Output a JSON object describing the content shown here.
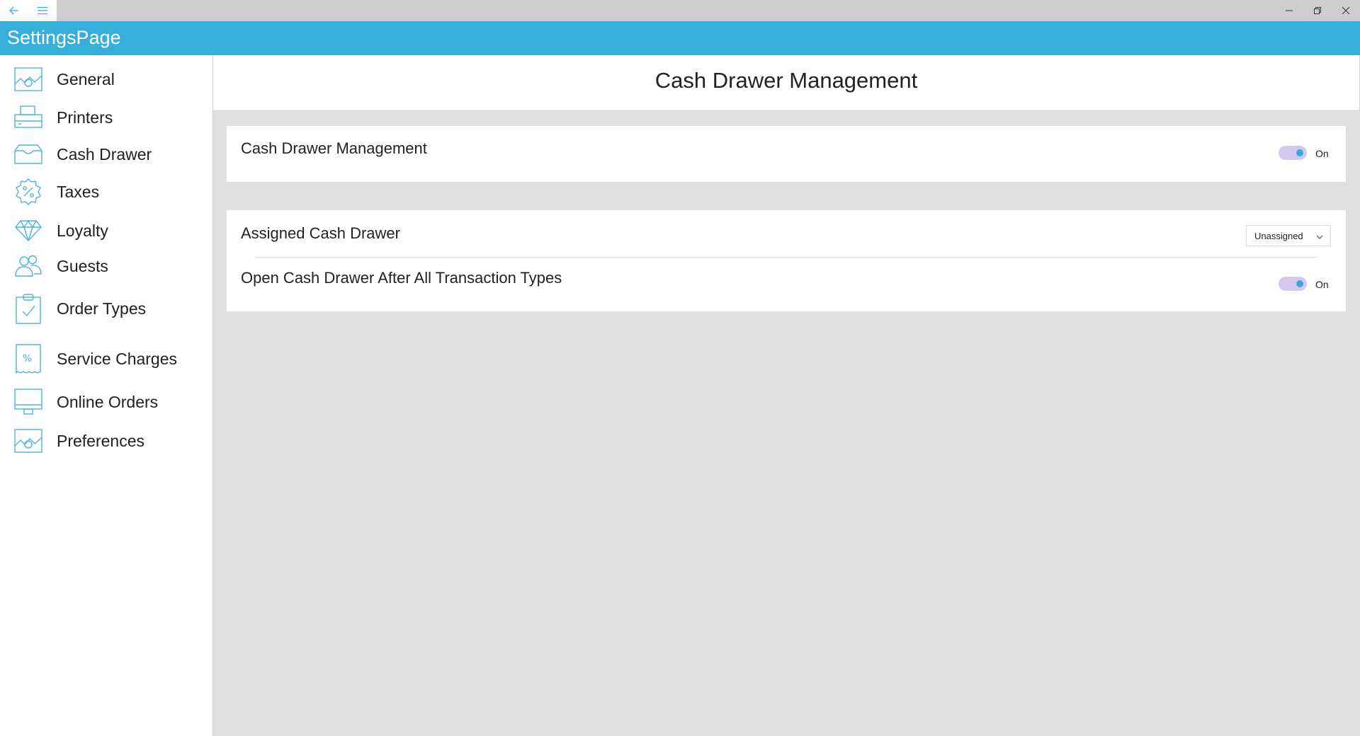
{
  "window": {
    "back_icon": "back-arrow-icon",
    "menu_icon": "hamburger-icon",
    "controls": [
      "minimize-icon",
      "restore-icon",
      "close-icon"
    ]
  },
  "app": {
    "title": "SettingsPage",
    "accent": "#38aedb"
  },
  "sidebar": {
    "items": [
      {
        "label": "General",
        "icon": "settings-gear-icon"
      },
      {
        "label": "Printers",
        "icon": "printer-icon"
      },
      {
        "label": "Cash Drawer",
        "icon": "cash-drawer-icon"
      },
      {
        "label": "Taxes",
        "icon": "percent-badge-icon"
      },
      {
        "label": "Loyalty",
        "icon": "diamond-icon"
      },
      {
        "label": "Guests",
        "icon": "guests-icon"
      },
      {
        "label": "Order Types",
        "icon": "clipboard-check-icon"
      },
      {
        "label": "Service Charges",
        "icon": "receipt-percent-icon"
      },
      {
        "label": "Online Orders",
        "icon": "monitor-icon"
      },
      {
        "label": "Preferences",
        "icon": "settings-gear-icon"
      }
    ]
  },
  "main": {
    "title": "Cash Drawer Management",
    "card1": {
      "label": "Cash Drawer Management",
      "toggle_state": "On"
    },
    "card2": {
      "assigned_label": "Assigned Cash Drawer",
      "assigned_value": "Unassigned",
      "open_after_label": "Open Cash Drawer After All Transaction Types",
      "open_after_state": "On"
    }
  },
  "colors": {
    "toggle_track": "#d4c8ef",
    "toggle_knob": "#3aa8dc",
    "icon_stroke": "#4fb3dc"
  }
}
